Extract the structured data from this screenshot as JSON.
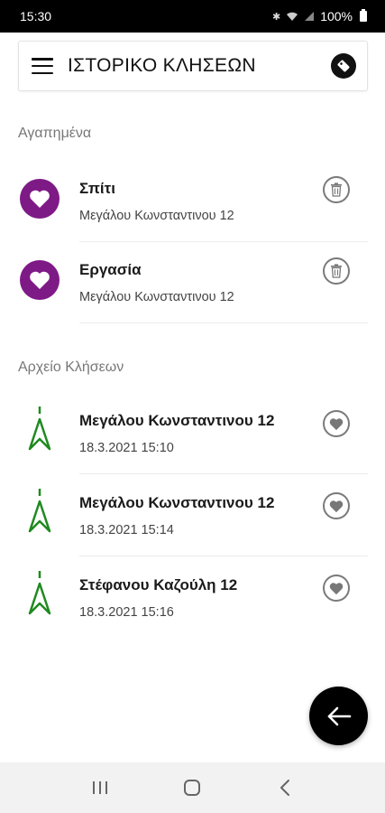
{
  "status_bar": {
    "time": "15:30",
    "battery": "100%",
    "icons": [
      "bluetooth-icon",
      "wifi-icon",
      "signal-icon",
      "battery-icon"
    ]
  },
  "app_bar": {
    "title": "ΙΣΤΟΡΙΚΟ ΚΛΗΣΕΩΝ",
    "menu_icon": "menu-icon",
    "action_icon": "tag-icon"
  },
  "favorites": {
    "title": "Αγαπημένα",
    "items": [
      {
        "name": "Σπίτι",
        "address": "Μεγάλου Κωνσταντινου 12",
        "icon": "heart-icon",
        "action_icon": "trash-icon"
      },
      {
        "name": "Εργασία",
        "address": "Μεγάλου Κωνσταντινου 12",
        "icon": "heart-icon",
        "action_icon": "trash-icon"
      }
    ]
  },
  "history": {
    "title": "Αρχείο Κλήσεων",
    "items": [
      {
        "address": "Μεγάλου Κωνσταντινου 12",
        "datetime": "18.3.2021 15:10",
        "icon": "navigation-icon",
        "action_icon": "favorite-icon"
      },
      {
        "address": "Μεγάλου Κωνσταντινου 12",
        "datetime": "18.3.2021 15:14",
        "icon": "navigation-icon",
        "action_icon": "favorite-icon"
      },
      {
        "address": "Στέφανου Καζούλη 12",
        "datetime": "18.3.2021 15:16",
        "icon": "navigation-icon",
        "action_icon": "favorite-icon"
      }
    ]
  },
  "fab": {
    "icon": "arrow-left-icon"
  },
  "nav_bar": {
    "icons": [
      "recent-apps-icon",
      "home-icon",
      "back-icon"
    ]
  },
  "colors": {
    "accent_purple": "#7e1a86",
    "nav_green": "#1f8a1f",
    "text_dark": "#1a1a1a",
    "text_muted": "#777777"
  }
}
